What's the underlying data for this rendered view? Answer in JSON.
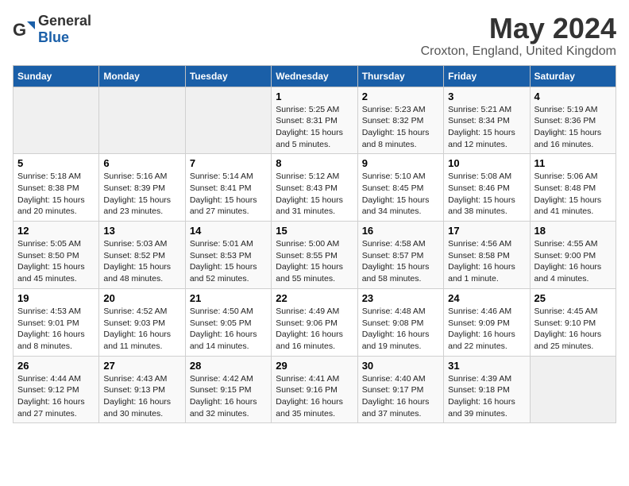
{
  "header": {
    "logo_general": "General",
    "logo_blue": "Blue",
    "title": "May 2024",
    "location": "Croxton, England, United Kingdom"
  },
  "weekdays": [
    "Sunday",
    "Monday",
    "Tuesday",
    "Wednesday",
    "Thursday",
    "Friday",
    "Saturday"
  ],
  "weeks": [
    [
      {
        "day": "",
        "info": ""
      },
      {
        "day": "",
        "info": ""
      },
      {
        "day": "",
        "info": ""
      },
      {
        "day": "1",
        "info": "Sunrise: 5:25 AM\nSunset: 8:31 PM\nDaylight: 15 hours\nand 5 minutes."
      },
      {
        "day": "2",
        "info": "Sunrise: 5:23 AM\nSunset: 8:32 PM\nDaylight: 15 hours\nand 8 minutes."
      },
      {
        "day": "3",
        "info": "Sunrise: 5:21 AM\nSunset: 8:34 PM\nDaylight: 15 hours\nand 12 minutes."
      },
      {
        "day": "4",
        "info": "Sunrise: 5:19 AM\nSunset: 8:36 PM\nDaylight: 15 hours\nand 16 minutes."
      }
    ],
    [
      {
        "day": "5",
        "info": "Sunrise: 5:18 AM\nSunset: 8:38 PM\nDaylight: 15 hours\nand 20 minutes."
      },
      {
        "day": "6",
        "info": "Sunrise: 5:16 AM\nSunset: 8:39 PM\nDaylight: 15 hours\nand 23 minutes."
      },
      {
        "day": "7",
        "info": "Sunrise: 5:14 AM\nSunset: 8:41 PM\nDaylight: 15 hours\nand 27 minutes."
      },
      {
        "day": "8",
        "info": "Sunrise: 5:12 AM\nSunset: 8:43 PM\nDaylight: 15 hours\nand 31 minutes."
      },
      {
        "day": "9",
        "info": "Sunrise: 5:10 AM\nSunset: 8:45 PM\nDaylight: 15 hours\nand 34 minutes."
      },
      {
        "day": "10",
        "info": "Sunrise: 5:08 AM\nSunset: 8:46 PM\nDaylight: 15 hours\nand 38 minutes."
      },
      {
        "day": "11",
        "info": "Sunrise: 5:06 AM\nSunset: 8:48 PM\nDaylight: 15 hours\nand 41 minutes."
      }
    ],
    [
      {
        "day": "12",
        "info": "Sunrise: 5:05 AM\nSunset: 8:50 PM\nDaylight: 15 hours\nand 45 minutes."
      },
      {
        "day": "13",
        "info": "Sunrise: 5:03 AM\nSunset: 8:52 PM\nDaylight: 15 hours\nand 48 minutes."
      },
      {
        "day": "14",
        "info": "Sunrise: 5:01 AM\nSunset: 8:53 PM\nDaylight: 15 hours\nand 52 minutes."
      },
      {
        "day": "15",
        "info": "Sunrise: 5:00 AM\nSunset: 8:55 PM\nDaylight: 15 hours\nand 55 minutes."
      },
      {
        "day": "16",
        "info": "Sunrise: 4:58 AM\nSunset: 8:57 PM\nDaylight: 15 hours\nand 58 minutes."
      },
      {
        "day": "17",
        "info": "Sunrise: 4:56 AM\nSunset: 8:58 PM\nDaylight: 16 hours\nand 1 minute."
      },
      {
        "day": "18",
        "info": "Sunrise: 4:55 AM\nSunset: 9:00 PM\nDaylight: 16 hours\nand 4 minutes."
      }
    ],
    [
      {
        "day": "19",
        "info": "Sunrise: 4:53 AM\nSunset: 9:01 PM\nDaylight: 16 hours\nand 8 minutes."
      },
      {
        "day": "20",
        "info": "Sunrise: 4:52 AM\nSunset: 9:03 PM\nDaylight: 16 hours\nand 11 minutes."
      },
      {
        "day": "21",
        "info": "Sunrise: 4:50 AM\nSunset: 9:05 PM\nDaylight: 16 hours\nand 14 minutes."
      },
      {
        "day": "22",
        "info": "Sunrise: 4:49 AM\nSunset: 9:06 PM\nDaylight: 16 hours\nand 16 minutes."
      },
      {
        "day": "23",
        "info": "Sunrise: 4:48 AM\nSunset: 9:08 PM\nDaylight: 16 hours\nand 19 minutes."
      },
      {
        "day": "24",
        "info": "Sunrise: 4:46 AM\nSunset: 9:09 PM\nDaylight: 16 hours\nand 22 minutes."
      },
      {
        "day": "25",
        "info": "Sunrise: 4:45 AM\nSunset: 9:10 PM\nDaylight: 16 hours\nand 25 minutes."
      }
    ],
    [
      {
        "day": "26",
        "info": "Sunrise: 4:44 AM\nSunset: 9:12 PM\nDaylight: 16 hours\nand 27 minutes."
      },
      {
        "day": "27",
        "info": "Sunrise: 4:43 AM\nSunset: 9:13 PM\nDaylight: 16 hours\nand 30 minutes."
      },
      {
        "day": "28",
        "info": "Sunrise: 4:42 AM\nSunset: 9:15 PM\nDaylight: 16 hours\nand 32 minutes."
      },
      {
        "day": "29",
        "info": "Sunrise: 4:41 AM\nSunset: 9:16 PM\nDaylight: 16 hours\nand 35 minutes."
      },
      {
        "day": "30",
        "info": "Sunrise: 4:40 AM\nSunset: 9:17 PM\nDaylight: 16 hours\nand 37 minutes."
      },
      {
        "day": "31",
        "info": "Sunrise: 4:39 AM\nSunset: 9:18 PM\nDaylight: 16 hours\nand 39 minutes."
      },
      {
        "day": "",
        "info": ""
      }
    ]
  ]
}
